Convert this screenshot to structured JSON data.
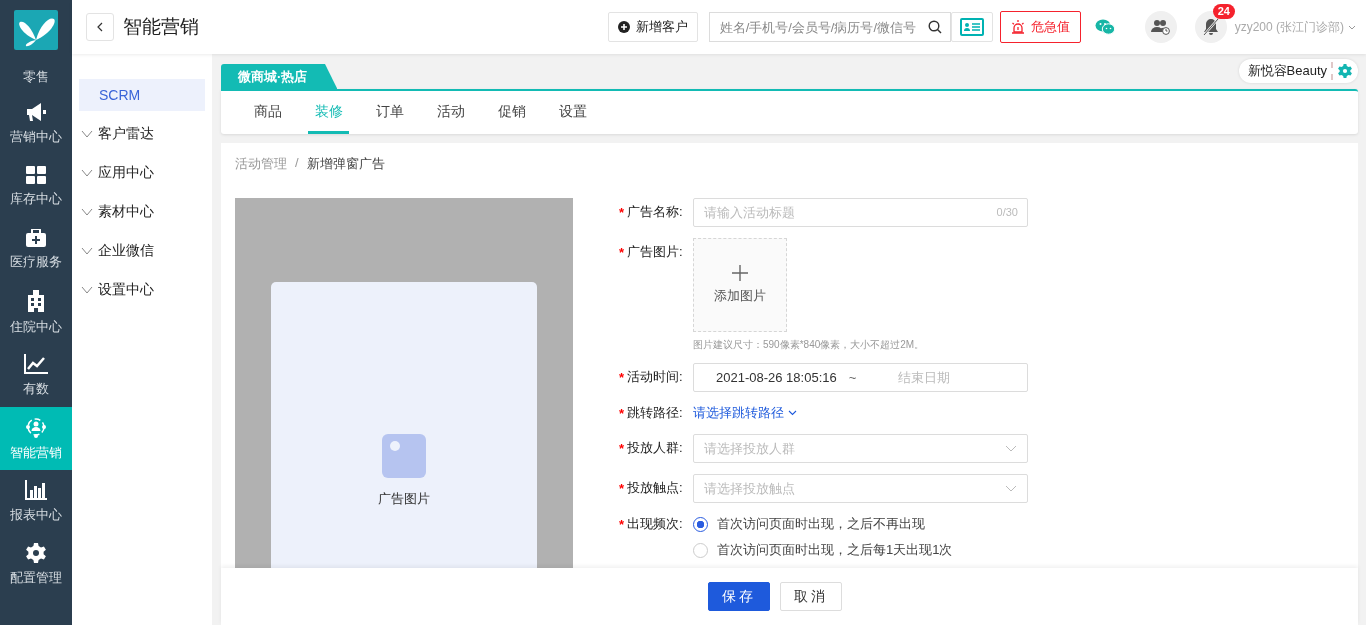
{
  "rail": {
    "items": [
      {
        "label": "零售",
        "selected": false
      },
      {
        "label": "营销中心",
        "selected": false
      },
      {
        "label": "库存中心",
        "selected": false
      },
      {
        "label": "医疗服务",
        "selected": false
      },
      {
        "label": "住院中心",
        "selected": false
      },
      {
        "label": "有数",
        "selected": false
      },
      {
        "label": "智能营销",
        "selected": true
      },
      {
        "label": "报表中心",
        "selected": false
      },
      {
        "label": "配置管理",
        "selected": false
      }
    ]
  },
  "header": {
    "title": "智能营销",
    "add_button": "新增客户",
    "search": {
      "placeholder": "姓名/手机号/会员号/病历号/微信号"
    },
    "alert_button": "危急值",
    "notification_count": "24",
    "user": "yzy200 (张江门诊部)"
  },
  "submenu": {
    "items": [
      {
        "label": "SCRM",
        "kind": "link",
        "selected": true
      },
      {
        "label": "客户雷达",
        "kind": "group",
        "selected": false
      },
      {
        "label": "应用中心",
        "kind": "group",
        "selected": false
      },
      {
        "label": "素材中心",
        "kind": "group",
        "selected": false
      },
      {
        "label": "企业微信",
        "kind": "group",
        "selected": false
      },
      {
        "label": "设置中心",
        "kind": "group",
        "selected": false
      }
    ]
  },
  "shop_tab": "微商城·热店",
  "store": "新悦容Beauty",
  "tabs": [
    {
      "label": "商品",
      "selected": false
    },
    {
      "label": "装修",
      "selected": true
    },
    {
      "label": "订单",
      "selected": false
    },
    {
      "label": "活动",
      "selected": false
    },
    {
      "label": "促销",
      "selected": false
    },
    {
      "label": "设置",
      "selected": false
    }
  ],
  "breadcrumb": {
    "items": [
      "活动管理",
      "新增弹窗广告"
    ],
    "separator": "/"
  },
  "preview": {
    "label": "广告图片"
  },
  "form": [
    {
      "kind": "text",
      "label": "广告名称:",
      "required_mark": "*",
      "placeholder": "请输入活动标题",
      "counter": "0/30"
    },
    {
      "kind": "upload",
      "label": "广告图片:",
      "required_mark": "*",
      "button": "添加图片",
      "hint": "图片建议尺寸：590像素*840像素，大小不超过2M。"
    },
    {
      "kind": "daterange",
      "label": "活动时间:",
      "required_mark": "*",
      "start": "2021-08-26 18:05:16",
      "separator": "~",
      "end_placeholder": "结束日期"
    },
    {
      "kind": "link",
      "label": "跳转路径:",
      "required_mark": "*",
      "value": "请选择跳转路径"
    },
    {
      "kind": "select",
      "label": "投放人群:",
      "required_mark": "*",
      "placeholder": "请选择投放人群"
    },
    {
      "kind": "select",
      "label": "投放触点:",
      "required_mark": "*",
      "placeholder": "请选择投放触点"
    },
    {
      "kind": "radio",
      "label": "出现频次:",
      "required_mark": "*",
      "options": [
        {
          "label": "首次访问页面时出现，之后不再出现",
          "selected": true
        },
        {
          "label": "首次访问页面时出现，之后每1天出现1次",
          "selected": false
        }
      ]
    }
  ],
  "footer": [
    {
      "label": "保存",
      "kind": "primary"
    },
    {
      "label": "取消",
      "kind": "default"
    }
  ]
}
